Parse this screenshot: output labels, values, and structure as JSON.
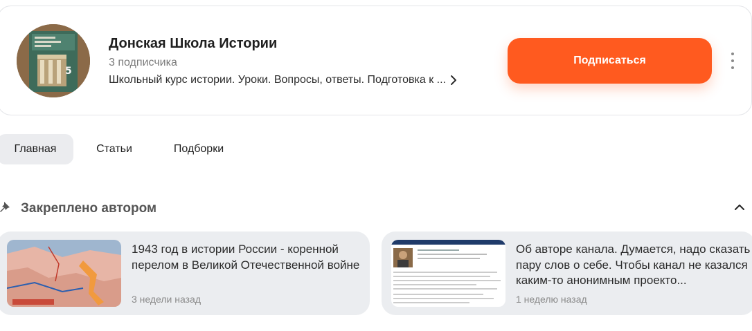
{
  "channel": {
    "title": "Донская Школа Истории",
    "subscribers": "3 подписчика",
    "description": "Школьный курс истории. Уроки. Вопросы, ответы. Подготовка к ...",
    "subscribe_label": "Подписаться",
    "avatar_icon": "history-textbook-cover",
    "accent_color": "#ff5a1f"
  },
  "tabs": [
    {
      "label": "Главная",
      "active": true
    },
    {
      "label": "Статьи",
      "active": false
    },
    {
      "label": "Подборки",
      "active": false
    }
  ],
  "pinned": {
    "heading": "Закреплено автором",
    "icon": "pin-icon",
    "posts": [
      {
        "title": "1943 год в истории России - коренной перелом в Великой Отечественной войне",
        "time": "3 недели назад",
        "thumb_icon": "war-map-thumbnail"
      },
      {
        "title": "Об авторе канала. Думается, надо сказать пару слов о себе. Чтобы канал не казался каким-то анонимным проекто...",
        "time": "1 неделю назад",
        "thumb_icon": "profile-page-thumbnail"
      }
    ]
  }
}
